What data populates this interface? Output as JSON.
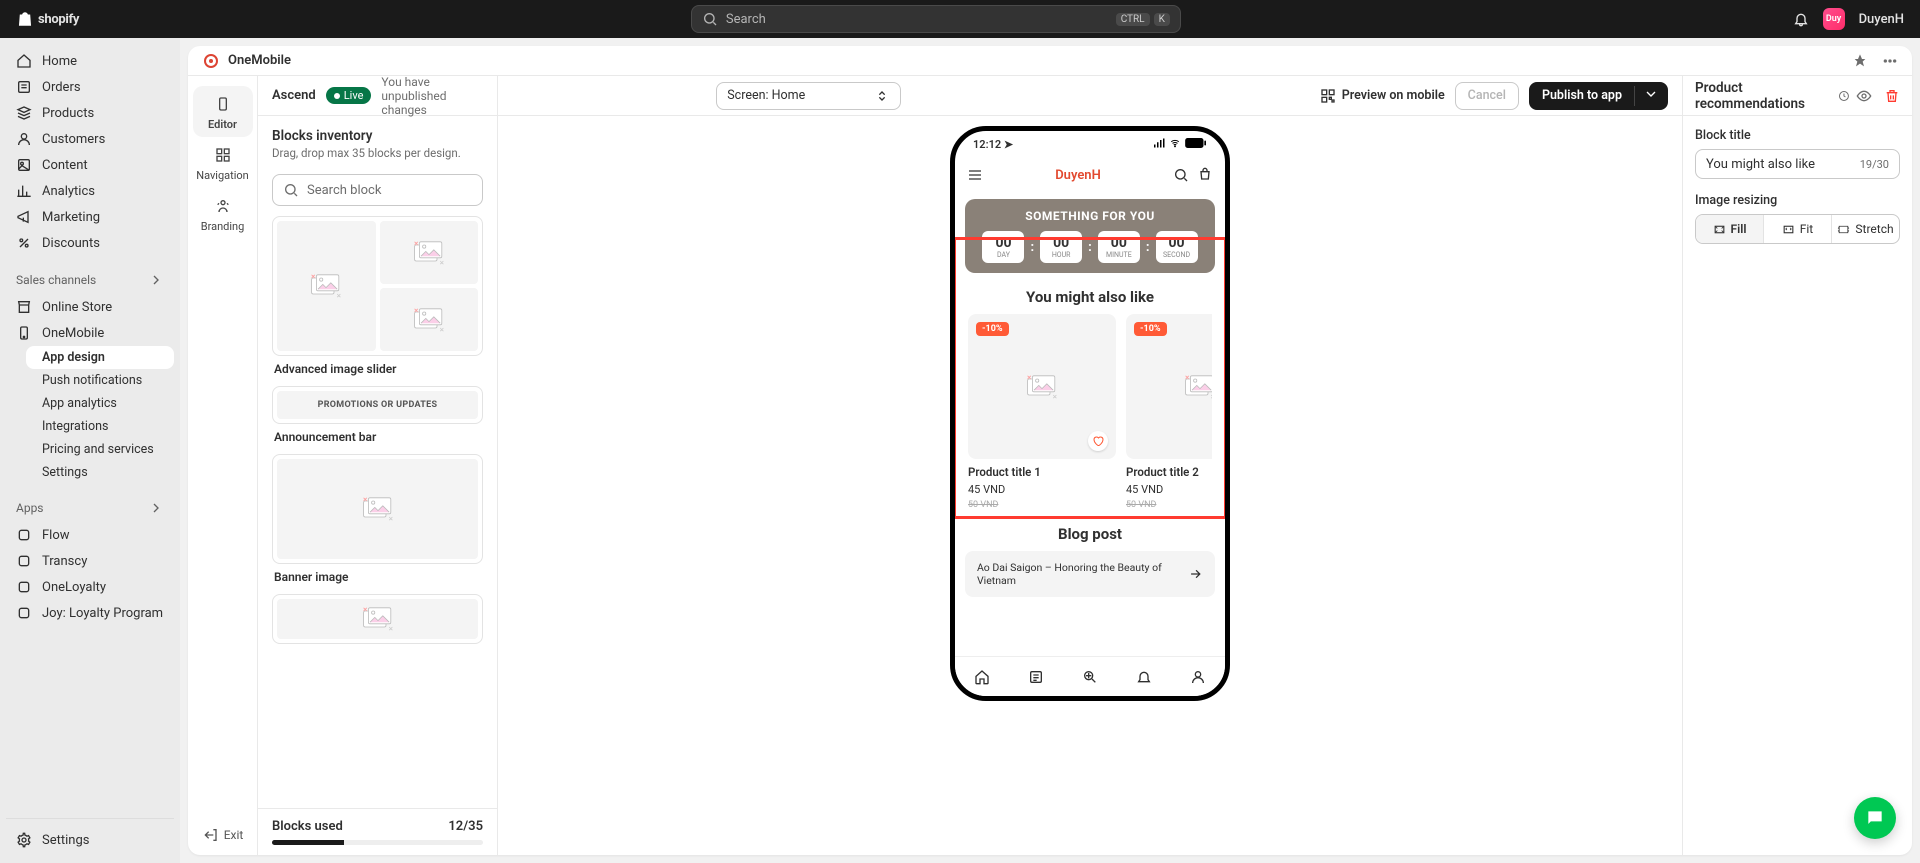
{
  "topbar": {
    "brand": "shopify",
    "search_placeholder": "Search",
    "kbd_ctrl": "CTRL",
    "kbd_k": "K",
    "username": "DuyenH",
    "avatar_initials": "Duy"
  },
  "shopnav": {
    "primary": [
      {
        "label": "Home",
        "icon": "home"
      },
      {
        "label": "Orders",
        "icon": "orders"
      },
      {
        "label": "Products",
        "icon": "products"
      },
      {
        "label": "Customers",
        "icon": "customers"
      },
      {
        "label": "Content",
        "icon": "content"
      },
      {
        "label": "Analytics",
        "icon": "analytics"
      },
      {
        "label": "Marketing",
        "icon": "marketing"
      },
      {
        "label": "Discounts",
        "icon": "discounts"
      }
    ],
    "sales_channels_label": "Sales channels",
    "channels": [
      {
        "label": "Online Store",
        "icon": "store"
      },
      {
        "label": "OneMobile",
        "icon": "onemobile",
        "expanded": true
      }
    ],
    "onemobile_sub": [
      {
        "label": "App design",
        "active": true
      },
      {
        "label": "Push notifications"
      },
      {
        "label": "App analytics"
      },
      {
        "label": "Integrations"
      },
      {
        "label": "Pricing and services"
      },
      {
        "label": "Settings"
      }
    ],
    "apps_label": "Apps",
    "apps": [
      {
        "label": "Flow"
      },
      {
        "label": "Transcy"
      },
      {
        "label": "OneLoyalty"
      },
      {
        "label": "Joy: Loyalty Program"
      }
    ],
    "settings_label": "Settings"
  },
  "app": {
    "name": "OneMobile",
    "theme_name": "Ascend",
    "live_badge": "Live",
    "unpublished_msg": "You have unpublished changes",
    "screen_selector_prefix": "Screen: ",
    "screen_selector_value": "Home",
    "preview_label": "Preview on mobile",
    "cancel_label": "Cancel",
    "publish_label": "Publish to app"
  },
  "rail": {
    "tabs": [
      {
        "label": "Editor",
        "active": true
      },
      {
        "label": "Navigation"
      },
      {
        "label": "Branding"
      }
    ],
    "exit_label": "Exit"
  },
  "blocks_panel": {
    "inventory_title": "Blocks inventory",
    "inventory_desc": "Drag, drop max 35 blocks per design.",
    "search_placeholder": "Search block",
    "previews": [
      {
        "label": "Advanced image slider",
        "type": "adv"
      },
      {
        "label": "Announcement bar",
        "type": "ann",
        "text": "PROMOTIONS OR UPDATES"
      },
      {
        "label": "Banner image",
        "type": "banner"
      }
    ],
    "used_label": "Blocks used",
    "used_count": "12/35"
  },
  "preview": {
    "status_time": "12:12",
    "store_name": "DuyenH",
    "hero_title": "SOMETHING FOR YOU",
    "counters": [
      {
        "num": "00",
        "lbl": "DAY"
      },
      {
        "num": "00",
        "lbl": "HOUR"
      },
      {
        "num": "00",
        "lbl": "MINUTE"
      },
      {
        "num": "00",
        "lbl": "SECOND"
      }
    ],
    "section_title": "You might also like",
    "products": [
      {
        "badge": "-10%",
        "title": "Product title 1",
        "price": "45 VND",
        "old": "50 VND",
        "heart": true
      },
      {
        "badge": "-10%",
        "title": "Product title 2",
        "price": "45 VND",
        "old": "50 VND",
        "heart": false
      }
    ],
    "blog_title": "Blog post",
    "blog_item": "Ao Dai Saigon – Honoring the Beauty of Vietnam"
  },
  "config": {
    "header": "Product recommendations",
    "block_title_label": "Block title",
    "block_title_value": "You might also like",
    "block_title_count": "19/30",
    "image_resize_label": "Image resizing",
    "resize_opts": [
      "Fill",
      "Fit",
      "Stretch"
    ],
    "resize_active": "Fill"
  }
}
